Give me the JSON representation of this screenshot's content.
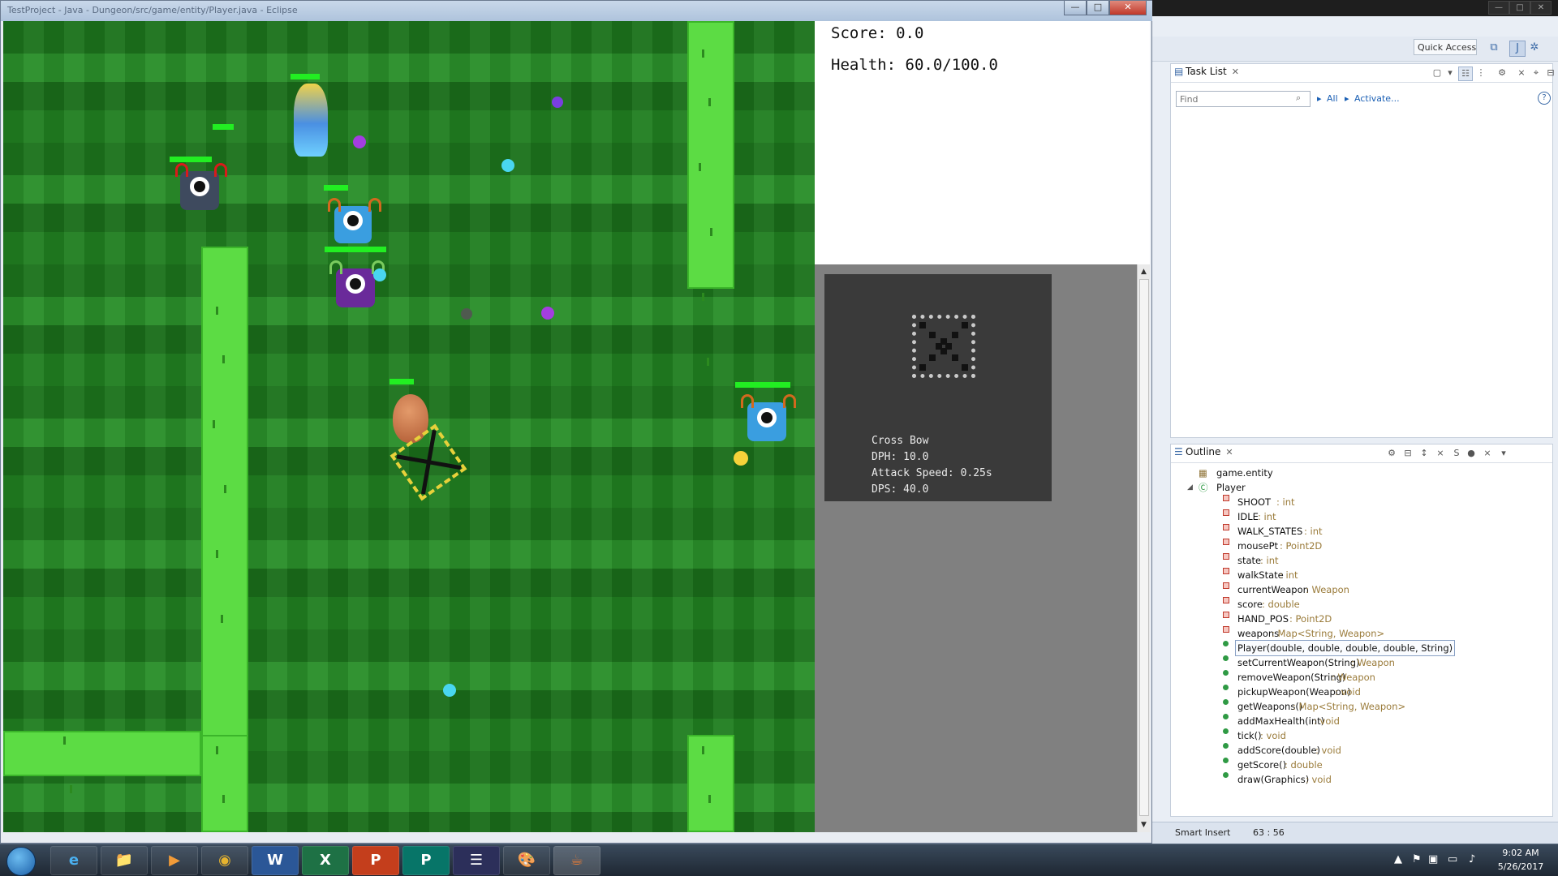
{
  "game_window": {
    "title": "TestProject - Java - Dungeon/src/game/entity/Player.java - Eclipse",
    "min_glyph": "—",
    "max_glyph": "□",
    "close_glyph": "✕"
  },
  "hud": {
    "score": "Score: 0.0",
    "health": "Health: 60.0/100.0"
  },
  "weapon_card": {
    "name": "Cross Bow",
    "dph": "DPH: 10.0",
    "attack_speed": "Attack Speed: 0.25s",
    "dps": "DPS: 40.0"
  },
  "scrollbar": {
    "up": "▲",
    "down": "▼"
  },
  "ide": {
    "quick_access": "Quick Access",
    "tasklist": {
      "title": "Task List",
      "find_placeholder": "Find",
      "all_link": "All",
      "activate_link": "Activate...",
      "help": "?"
    },
    "outline": {
      "title": "Outline",
      "rows": [
        {
          "label": "game.entity",
          "type": ""
        },
        {
          "label": "Player",
          "type": ""
        },
        {
          "label": "SHOOT",
          "type": " : int"
        },
        {
          "label": "IDLE",
          "type": " : int"
        },
        {
          "label": "WALK_STATES",
          "type": " : int"
        },
        {
          "label": "mousePt",
          "type": " : Point2D"
        },
        {
          "label": "state",
          "type": " : int"
        },
        {
          "label": "walkState",
          "type": " : int"
        },
        {
          "label": "currentWeapon",
          "type": " : Weapon"
        },
        {
          "label": "score",
          "type": " : double"
        },
        {
          "label": "HAND_POS",
          "type": " : Point2D"
        },
        {
          "label": "weapons",
          "type": " : Map<String, Weapon>"
        },
        {
          "label": "Player(double, double, double, double, String)",
          "type": ""
        },
        {
          "label": "setCurrentWeapon(String)",
          "type": " : Weapon"
        },
        {
          "label": "removeWeapon(String)",
          "type": " : Weapon"
        },
        {
          "label": "pickupWeapon(Weapon)",
          "type": " : void"
        },
        {
          "label": "getWeapons()",
          "type": " : Map<String, Weapon>"
        },
        {
          "label": "addMaxHealth(int)",
          "type": " : void"
        },
        {
          "label": "tick()",
          "type": " : void"
        },
        {
          "label": "addScore(double)",
          "type": " : void"
        },
        {
          "label": "getScore()",
          "type": " : double"
        },
        {
          "label": "draw(Graphics)",
          "type": " : void"
        }
      ]
    },
    "status": {
      "mode": "Smart Insert",
      "position": "63 : 56"
    }
  },
  "taskbar": {
    "apps": [
      "e",
      "📁",
      "▶",
      "◉",
      "W",
      "X",
      "P",
      "P",
      "☰",
      "🎨",
      "☕"
    ],
    "time": "9:02 AM",
    "date": "5/26/2017"
  }
}
